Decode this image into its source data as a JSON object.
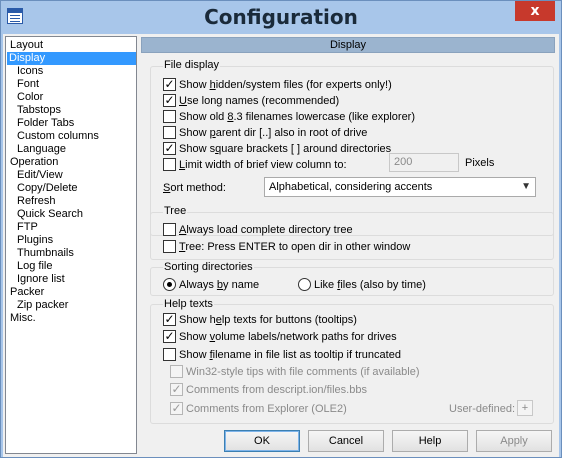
{
  "window": {
    "title": "Configuration",
    "close": "x"
  },
  "tree": {
    "items": [
      {
        "label": "Layout",
        "indent": 0
      },
      {
        "label": "Display",
        "indent": 0,
        "selected": true
      },
      {
        "label": "Icons",
        "indent": 1
      },
      {
        "label": "Font",
        "indent": 1
      },
      {
        "label": "Color",
        "indent": 1
      },
      {
        "label": "Tabstops",
        "indent": 1
      },
      {
        "label": "Folder Tabs",
        "indent": 1
      },
      {
        "label": "Custom columns",
        "indent": 1
      },
      {
        "label": "Language",
        "indent": 1
      },
      {
        "label": "Operation",
        "indent": 0
      },
      {
        "label": "Edit/View",
        "indent": 1
      },
      {
        "label": "Copy/Delete",
        "indent": 1
      },
      {
        "label": "Refresh",
        "indent": 1
      },
      {
        "label": "Quick Search",
        "indent": 1
      },
      {
        "label": "FTP",
        "indent": 1
      },
      {
        "label": "Plugins",
        "indent": 1
      },
      {
        "label": "Thumbnails",
        "indent": 1
      },
      {
        "label": "Log file",
        "indent": 1
      },
      {
        "label": "Ignore list",
        "indent": 1
      },
      {
        "label": "Packer",
        "indent": 0
      },
      {
        "label": "Zip packer",
        "indent": 1
      },
      {
        "label": "Misc.",
        "indent": 0
      }
    ]
  },
  "page": {
    "header": "Display"
  },
  "file_display": {
    "title": "File display",
    "show_hidden": "Show hidden/system files (for experts only!)",
    "long_names": "Use long names (recommended)",
    "old_83": "Show old 8.3 filenames lowercase (like explorer)",
    "parent_dir": "Show parent dir [..] also in root of drive",
    "square_brackets": "Show square brackets [ ] around directories",
    "limit_width": "Limit width of brief view column to:",
    "width_value": "200",
    "width_unit": "Pixels",
    "sort_label": "Sort method:",
    "sort_value": "Alphabetical, considering accents"
  },
  "tree_group": {
    "title": "Tree",
    "always_load": "Always load complete directory tree",
    "tree_enter": "Tree: Press ENTER to open dir in other window"
  },
  "sorting": {
    "title": "Sorting directories",
    "by_name": "Always by name",
    "like_files": "Like files (also by time)"
  },
  "help_texts": {
    "title": "Help texts",
    "show_help": "Show help texts for buttons (tooltips)",
    "volume_labels": "Show volume labels/network paths for drives",
    "filename_tooltip": "Show filename in file list as tooltip if truncated",
    "win32_tips": "Win32-style tips with file comments (if available)",
    "comments_descript": "Comments from descript.ion/files.bbs",
    "comments_explorer": "Comments from Explorer (OLE2)",
    "user_defined": "User-defined:",
    "plus": "+"
  },
  "buttons": {
    "ok": "OK",
    "cancel": "Cancel",
    "help": "Help",
    "apply": "Apply"
  }
}
